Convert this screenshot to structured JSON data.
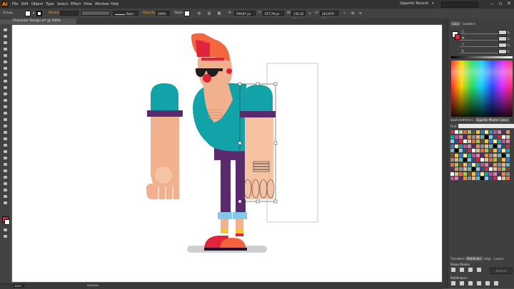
{
  "app": {
    "logo_text": "Ai",
    "workspace": "Gigantic Record",
    "search_placeholder": ""
  },
  "menu": [
    "File",
    "Edit",
    "Object",
    "Type",
    "Select",
    "Effect",
    "View",
    "Window",
    "Help"
  ],
  "control_bar": {
    "selection_label": "Group",
    "stroke_label": "Stroke:",
    "brush_label": "Basic",
    "opacity_label": "Opacity:",
    "opacity_value": "100%",
    "style_label": "Style:",
    "x_label": "X:",
    "x_value": "599,87 px",
    "y_label": "Y:",
    "y_value": "527,79 px",
    "w_label": "W:",
    "w_value": "136,16 px",
    "h_label": "H:",
    "h_value": "416,979 px"
  },
  "document_tab": "Character Design.ai* @ 100% (CMYK/Preview)",
  "panels": {
    "color_tabs": [
      "Color",
      "Gradient"
    ],
    "color_channels": [
      "C",
      "M",
      "Y",
      "K"
    ],
    "swatch_tabs": [
      "Swatches",
      "Pattern",
      "Gigantic Master Colors"
    ],
    "find_label": "Find:",
    "bottom_tabs": [
      "Transform",
      "Pathfinder",
      "Align",
      "Layers"
    ],
    "shape_modes": "Shape Modes:",
    "pathfinders": "Pathfinders:",
    "expand_label": "Expand"
  },
  "status": {
    "zoom": "100%",
    "tool": "Selection"
  },
  "colors": {
    "teal": "#11a3a8",
    "purple": "#5b2a6e",
    "skin": "#f1b18f",
    "hair": "#f4663f",
    "red": "#e0243c",
    "denim": "#86c8e8",
    "yellow": "#f6c431",
    "orange": "#f3623c",
    "shadow": "#cfcfcf"
  },
  "swatch_colors": [
    "#e0243c",
    "#f4663f",
    "#f6c431",
    "#11a3a8",
    "#5b2a6e",
    "#f1b18f",
    "#86c8e8",
    "#ffffff",
    "#9ccf44",
    "#2f7ad6",
    "#c04fa0",
    "#f28b44",
    "#68bdb1",
    "#314d8d",
    "#d4c59a",
    "#7b4a2c",
    "#f7ea8a",
    "#e07bb0",
    "#8e8e8e",
    "#000000"
  ]
}
